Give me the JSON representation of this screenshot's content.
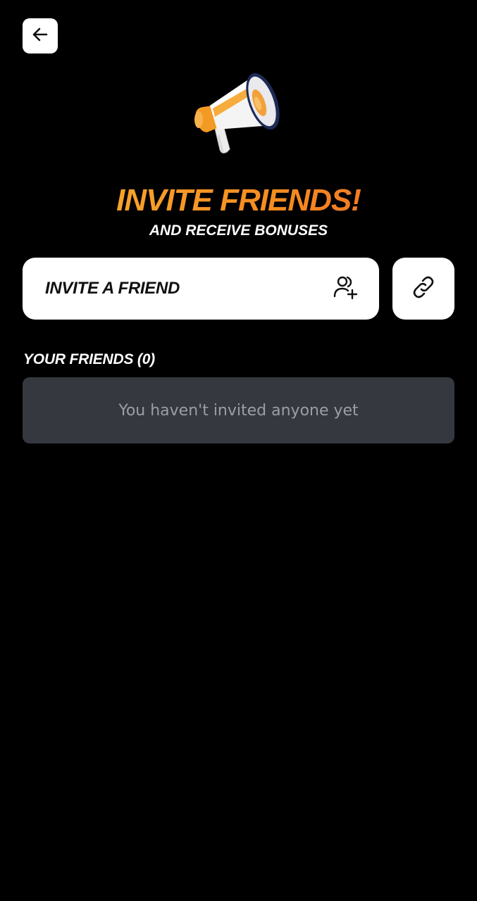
{
  "header": {
    "back_icon": "arrow-left-icon"
  },
  "hero": {
    "image": "megaphone-icon",
    "title": "INVITE FRIENDS!",
    "subtitle": "AND RECEIVE BONUSES",
    "title_gradient": [
      "#f9b233",
      "#f58a1f",
      "#f1652a"
    ]
  },
  "actions": {
    "invite_label": "INVITE A FRIEND",
    "invite_icon": "user-plus-icon",
    "link_icon": "link-icon"
  },
  "friends": {
    "heading": "YOUR FRIENDS (0)",
    "empty_text": "You haven't invited anyone yet"
  },
  "colors": {
    "background": "#000000",
    "button_bg": "#ffffff",
    "card_bg": "#363840",
    "muted_text": "#9c9ea6"
  }
}
